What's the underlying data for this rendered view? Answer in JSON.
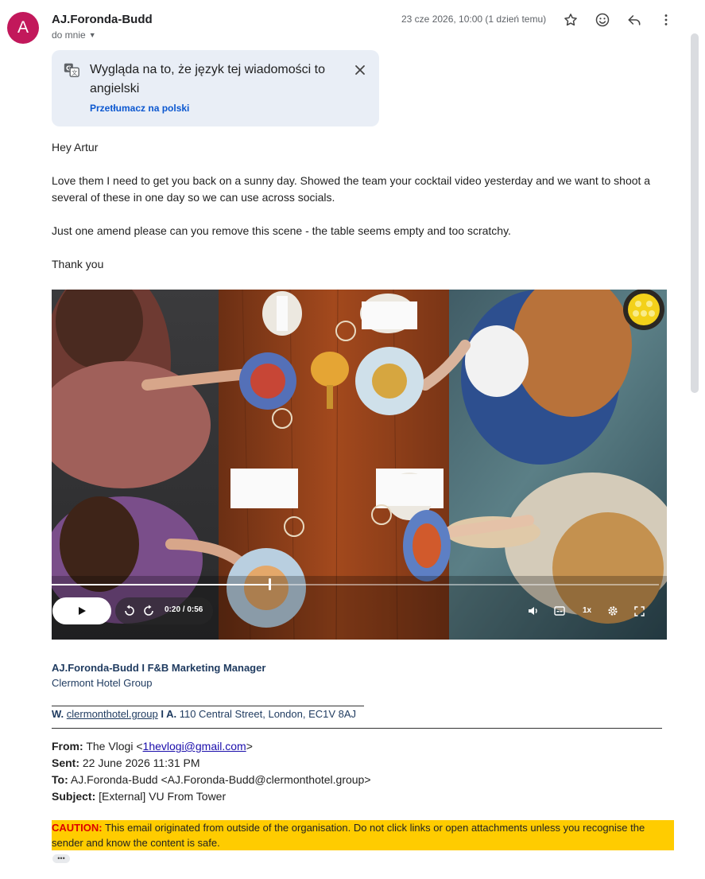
{
  "header": {
    "avatar_letter": "A",
    "sender": "AJ.Foronda-Budd",
    "recipient": "do mnie",
    "date": "23 cze 2026, 10:00 (1 dzień temu)"
  },
  "translate": {
    "text": "Wygląda na to, że język tej wiadomości to angielski",
    "link": "Przetłumacz na polski"
  },
  "body": {
    "greeting": "Hey Artur",
    "paragraph1": "Love them I need to get you back on a sunny day. Showed the team your cocktail video yesterday and we want to shoot a several of these in one day so we can use across socials.",
    "paragraph2": "Just one amend please can you remove this scene - the table seems empty and too scratchy.",
    "closing": "Thank you"
  },
  "video": {
    "time": "0:20 / 0:56",
    "speed": "1x",
    "progress": 0.357
  },
  "signature": {
    "name_title": "AJ.Foronda-Budd I F&B Marketing Manager",
    "company": "Clermont Hotel Group",
    "web_label": "W.",
    "web": "clermonthotel.group",
    "addr_label": "I A.",
    "address": "110 Central Street, London, EC1V 8AJ"
  },
  "forwarded": {
    "from_label": "From:",
    "from_name": "The Vlogi <",
    "from_email": "1hevlogi@gmail.com",
    "from_close": ">",
    "sent_label": "Sent:",
    "sent": "22 June 2026 11:31 PM",
    "to_label": "To:",
    "to": "AJ.Foronda-Budd <AJ.Foronda-Budd@clermonthotel.group>",
    "subject_label": "Subject:",
    "subject": "[External] VU From Tower"
  },
  "caution": {
    "label": "CAUTION:",
    "text": "This email originated from outside of the organisation. Do not click links or open attachments unless you recognise the sender and know the content is safe."
  },
  "more": "•••",
  "colors": {
    "avatar": "#c2185b",
    "link": "#0b57d0",
    "caution_bg": "#ffcc00",
    "caution_label": "#dd0000",
    "signature": "#1e3a5f"
  }
}
